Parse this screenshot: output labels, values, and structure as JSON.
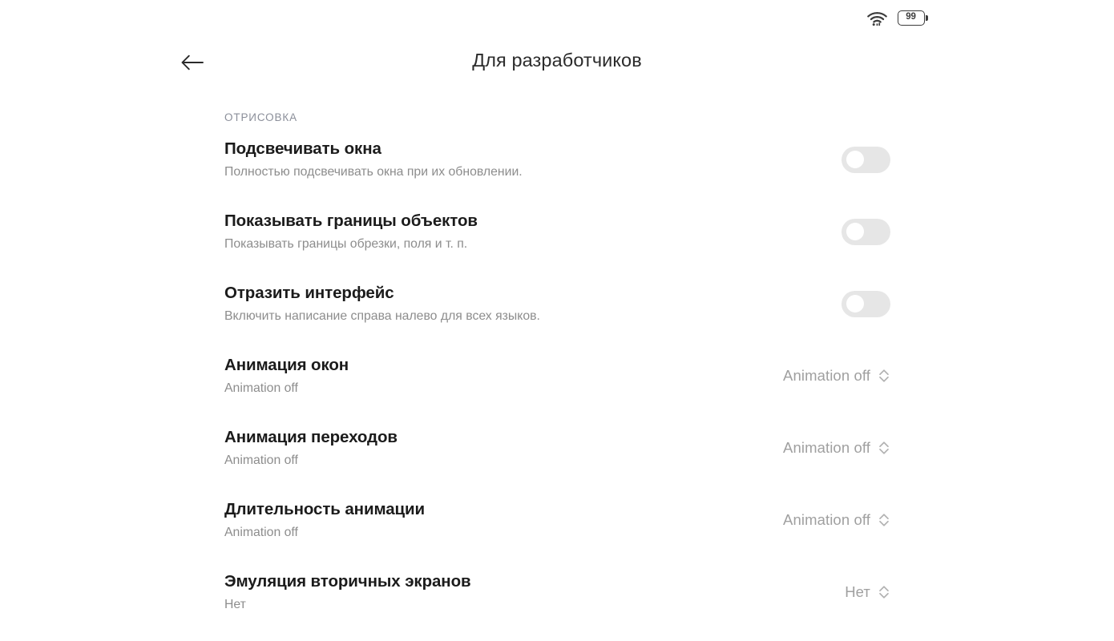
{
  "status_bar": {
    "wifi_icon": "wifi-icon",
    "battery_icon": "battery-icon",
    "battery_level": "99"
  },
  "app_bar": {
    "back_icon": "arrow-left-icon",
    "title": "Для разработчиков"
  },
  "section": {
    "header": "ОТРИСОВКА"
  },
  "rows": [
    {
      "title": "Подсвечивать окна",
      "summary": "Полностью подсвечивать окна при их обновлении.",
      "control": "toggle",
      "checked": false
    },
    {
      "title": "Показывать границы объектов",
      "summary": "Показывать границы обрезки, поля и т. п.",
      "control": "toggle",
      "checked": false
    },
    {
      "title": "Отразить интерфейс",
      "summary": "Включить написание справа налево для всех языков.",
      "control": "toggle",
      "checked": false
    },
    {
      "title": "Анимация окон",
      "summary": "Animation off",
      "control": "stepper",
      "value": "Animation off"
    },
    {
      "title": "Анимация переходов",
      "summary": "Animation off",
      "control": "stepper",
      "value": "Animation off"
    },
    {
      "title": "Длительность анимации",
      "summary": "Animation off",
      "control": "stepper",
      "value": "Animation off"
    },
    {
      "title": "Эмуляция вторичных экранов",
      "summary": "Нет",
      "control": "stepper",
      "value": "Нет"
    }
  ],
  "colors": {
    "title_text": "#1b1b1b",
    "summary_text": "#8d8d8d",
    "section_header": "#8b8f9a",
    "toggle_track": "#e6e6e6",
    "stepper_text": "#a0a0a0",
    "background": "#ffffff"
  }
}
